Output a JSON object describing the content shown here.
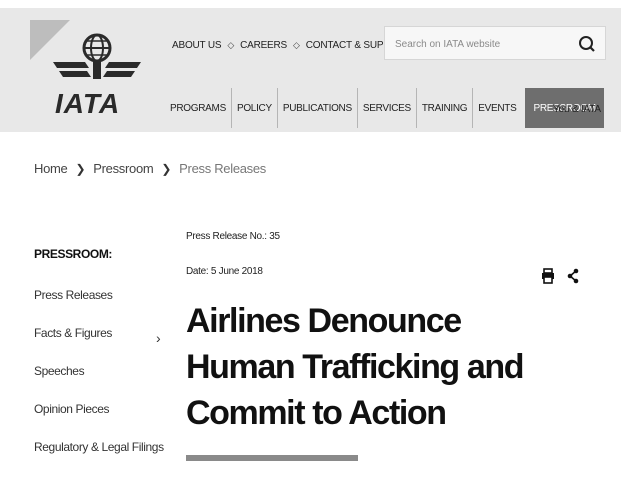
{
  "logo": {
    "text": "IATA"
  },
  "top_links": [
    "ABOUT US",
    "CAREERS",
    "CONTACT & SUPPORT"
  ],
  "top_links_separator": "◇",
  "search": {
    "placeholder": "Search on IATA website",
    "icon": "search-icon"
  },
  "main_nav": [
    "PROGRAMS",
    "POLICY",
    "PUBLICATIONS",
    "SERVICES",
    "TRAINING",
    "EVENTS"
  ],
  "main_nav_active": "PRESSROOM",
  "you_iata": "You & IATA",
  "breadcrumb": {
    "home": "Home",
    "pressroom": "Pressroom",
    "current": "Press Releases"
  },
  "sidebar": {
    "title": "PRESSROOM:",
    "items": [
      "Press Releases",
      "Facts & Figures",
      "Speeches",
      "Opinion Pieces",
      "Regulatory & Legal Filings"
    ]
  },
  "article": {
    "release_no": "Press Release No.: 35",
    "date": "Date: 5 June 2018",
    "headline_lines": [
      "Airlines Denounce",
      "Human Trafficking and",
      "Commit to Action"
    ]
  },
  "tools": {
    "print_icon": "print-icon",
    "share_icon": "share-icon"
  },
  "colors": {
    "header_bg": "#e8e8e8",
    "active_nav_bg": "#6e6e6e"
  }
}
